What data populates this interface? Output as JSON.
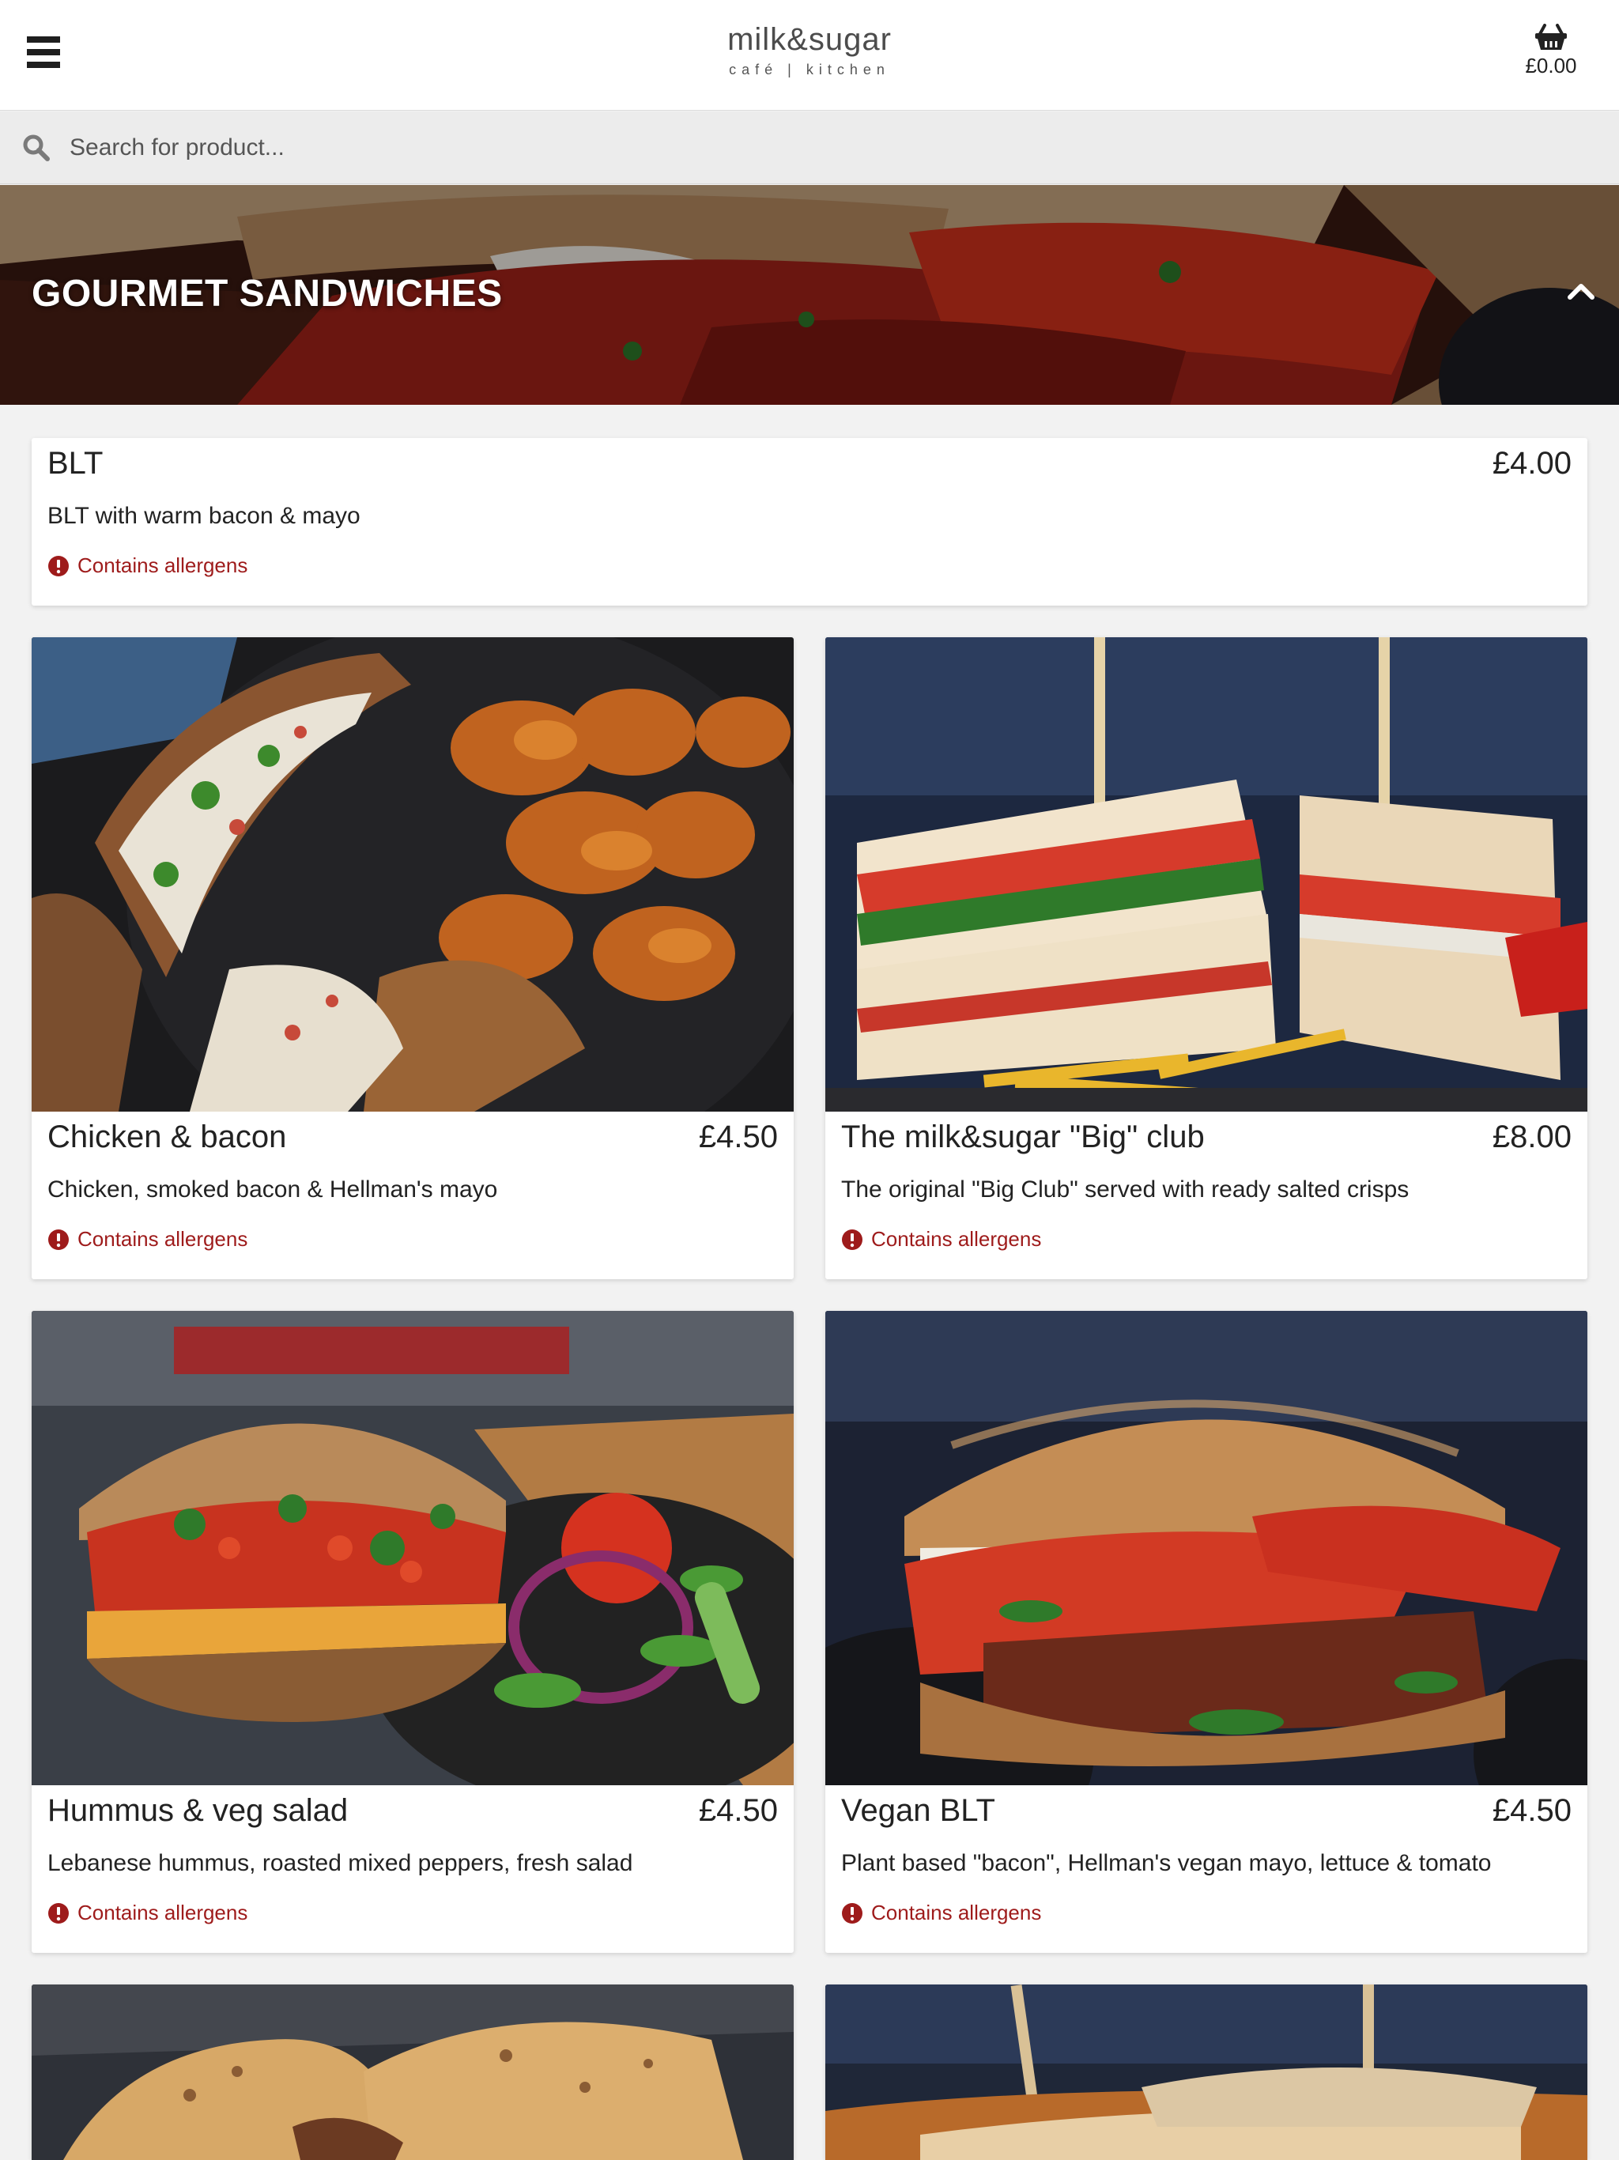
{
  "header": {
    "menu_icon": "hamburger-menu-icon",
    "logo_main": "milk&sugar",
    "logo_sub": "café | kitchen",
    "basket_icon": "basket-icon",
    "basket_total": "£0.00"
  },
  "search": {
    "icon": "search-icon",
    "placeholder": "Search for product..."
  },
  "category": {
    "title": "GOURMET SANDWICHES",
    "toggle_icon": "chevron-up-icon"
  },
  "allergen_label": "Contains allergens",
  "products": [
    {
      "name": "BLT",
      "price": "£4.00",
      "description": "BLT with warm bacon & mayo"
    },
    {
      "name": "Chicken & bacon",
      "price": "£4.50",
      "description": "Chicken, smoked bacon & Hellman's mayo"
    },
    {
      "name": "The milk&sugar \"Big\" club",
      "price": "£8.00",
      "description": "The original \"Big Club\" served with ready salted crisps"
    },
    {
      "name": "Hummus & veg salad",
      "price": "£4.50",
      "description": "Lebanese hummus, roasted mixed peppers, fresh salad"
    },
    {
      "name": "Vegan BLT",
      "price": "£4.50",
      "description": "Plant based \"bacon\", Hellman's vegan mayo, lettuce & tomato"
    }
  ],
  "colors": {
    "allergen": "#9e1b1b",
    "header_bg": "#ffffff",
    "search_bg": "#ececec"
  }
}
